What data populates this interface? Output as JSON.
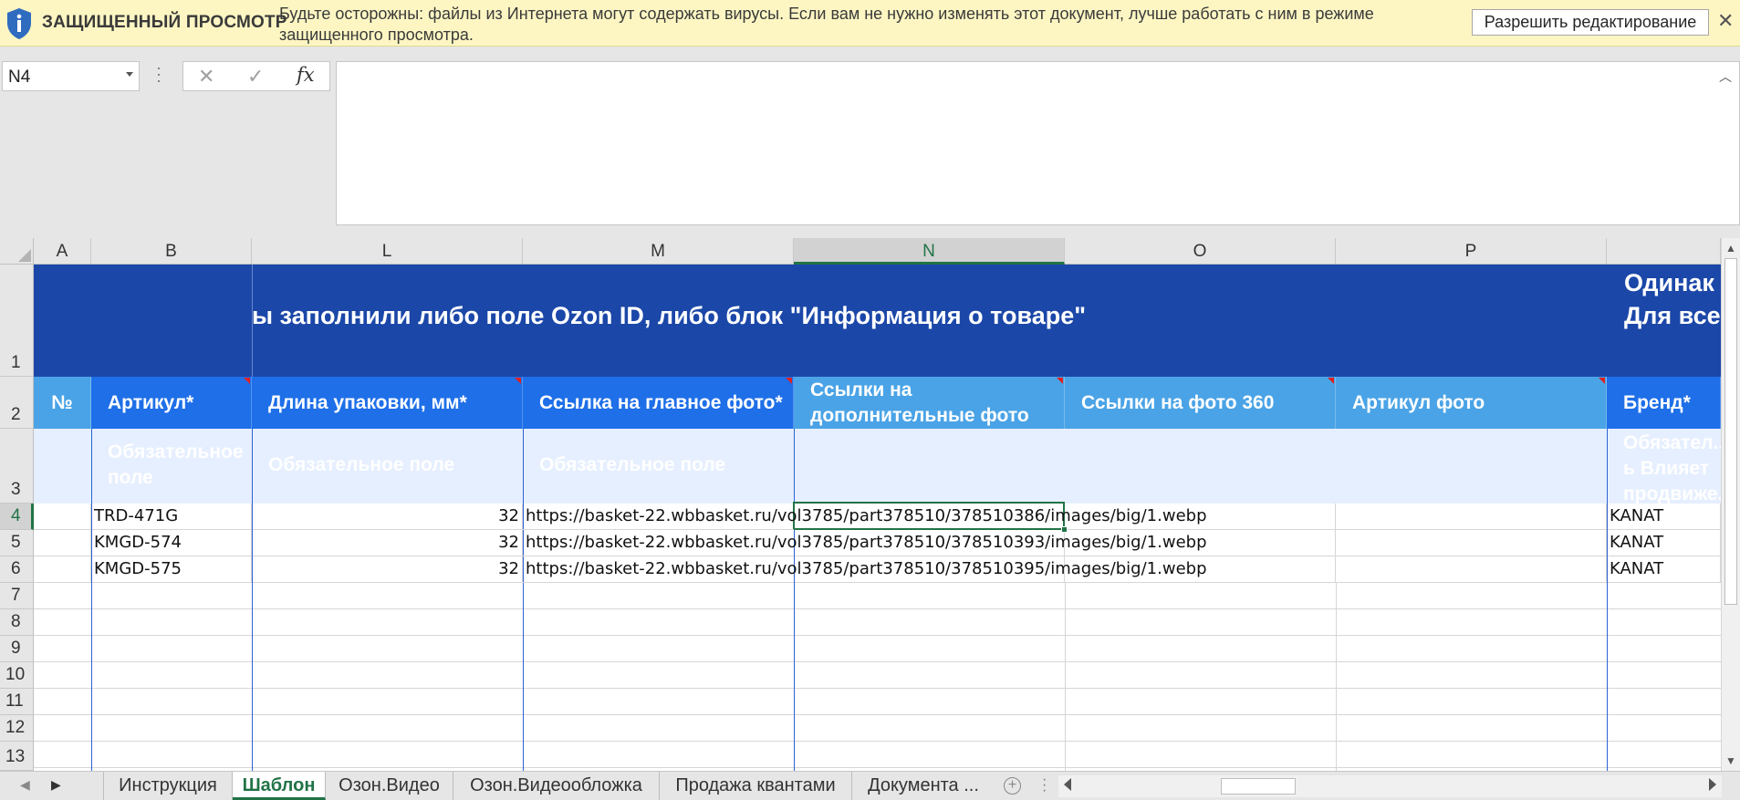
{
  "banner": {
    "title": "ЗАЩИЩЕННЫЙ ПРОСМОТР",
    "message": "Будьте осторожны: файлы из Интернета могут содержать вирусы. Если вам не нужно изменять этот документ, лучше работать с ним в режиме защищенного просмотра.",
    "enable_editing_label": "Разрешить редактирование",
    "close_glyph": "✕",
    "icon": "shield-info-icon"
  },
  "formula_bar": {
    "name_box": "N4",
    "cancel_glyph": "✕",
    "enter_glyph": "✓",
    "fx_label": "fx",
    "formula": ""
  },
  "columns": [
    "A",
    "B",
    "L",
    "M",
    "N",
    "O",
    "P"
  ],
  "selected_column": "N",
  "rows": [
    "1",
    "2",
    "3",
    "4",
    "5",
    "6",
    "7",
    "8",
    "9",
    "10",
    "11",
    "12",
    "13"
  ],
  "selected_row": "4",
  "row1": {
    "banner_text": "ы заполнили либо поле Ozon ID, либо блок \"Информация о товаре\"",
    "right_line1": "Одинак",
    "right_line2": "Для все"
  },
  "headers": {
    "num": "№",
    "article": "Артикул*",
    "length": "Длина упаковки, мм*",
    "main_photo": "Ссылка на главное фото*",
    "extra_photos": "Ссылки на дополнительные фото",
    "photo360": "Ссылки на фото 360",
    "photo_article": "Артикул фото",
    "brand": "Бренд*"
  },
  "row3": {
    "article": "Обязательное поле",
    "length": "Обязательное поле",
    "main_photo": "Обязательное поле",
    "brand": "Обязател... ь  Влияет продвиже..."
  },
  "data_rows": [
    {
      "article": "TRD-471G",
      "length": "32",
      "url": "https://basket-22.wbbasket.ru/vol3785/part378510/378510386/images/big/1.webp",
      "brand": "KANAT"
    },
    {
      "article": "KMGD-574",
      "length": "32",
      "url": "https://basket-22.wbbasket.ru/vol3785/part378510/378510393/images/big/1.webp",
      "brand": "KANAT"
    },
    {
      "article": "KMGD-575",
      "length": "32",
      "url": "https://basket-22.wbbasket.ru/vol3785/part378510/378510395/images/big/1.webp",
      "brand": "KANAT"
    }
  ],
  "sheet_tabs": [
    {
      "label": "Инструкция",
      "active": false
    },
    {
      "label": "Шаблон",
      "active": true
    },
    {
      "label": "Озон.Видео",
      "active": false
    },
    {
      "label": "Озон.Видеообложка",
      "active": false
    },
    {
      "label": "Продажа квантами",
      "active": false
    },
    {
      "label": "Документа ...",
      "active": false
    }
  ],
  "colors": {
    "banner_bg": "#fdf6c3",
    "header_dark_blue": "#1b47a8",
    "header_blue": "#1e6fe8",
    "header_light_blue": "#4aa3e6",
    "row3_bg": "#e6efff",
    "excel_green": "#217346"
  }
}
